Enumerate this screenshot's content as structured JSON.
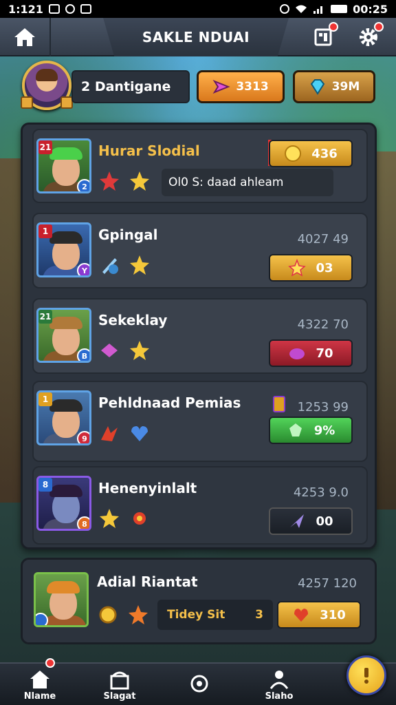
{
  "status_bar": {
    "time_left": "1:121",
    "time_right": "00:25"
  },
  "header": {
    "title": "SAKLE NDUAI"
  },
  "player": {
    "name": "2 Dantigane"
  },
  "currency": [
    {
      "value": "3313"
    },
    {
      "value": "39M"
    }
  ],
  "list": [
    {
      "level": "21",
      "class": "2",
      "name": "Hurar Slodial",
      "button": "436",
      "tag": "Ol0 S: daad ahleam",
      "icons": [
        "red-star-icon",
        "gold-star-icon"
      ]
    },
    {
      "level": "1",
      "class": "Y",
      "name": "Gpingal",
      "score": "4027 49",
      "button": "03",
      "icons": [
        "sword-shield-icon",
        "gold-star-icon"
      ]
    },
    {
      "level": "21",
      "class": "B",
      "name": "Sekeklay",
      "score": "4322 70",
      "button": "70",
      "icons": [
        "pink-gem-icon",
        "gold-star-icon"
      ]
    },
    {
      "level": "1",
      "class": "9",
      "name": "Pehldnaad Pemias",
      "score": "1253 99",
      "button": "9%",
      "icons": [
        "red-wing-icon",
        "blue-heart-icon"
      ]
    },
    {
      "level": "8",
      "class": "8",
      "name": "Henenyinlalt",
      "score": "4253 9.0",
      "button": "00",
      "icons": [
        "gold-star-icon",
        "red-flower-icon"
      ]
    }
  ],
  "card": {
    "name": "Adial Riantat",
    "score": "4257 120",
    "chip_label": "Tidey Sit",
    "chip_value": "3",
    "button": "310",
    "icons": [
      "gold-medal-icon",
      "fire-star-icon"
    ]
  },
  "bottom_nav": [
    {
      "label": "Nlame"
    },
    {
      "label": "Slagat"
    },
    {
      "label": ""
    },
    {
      "label": "Slaho"
    }
  ],
  "colors": {
    "accent_gold": "#f5c24a",
    "accent_red": "#cf3545",
    "accent_green": "#52d45a",
    "panel": "#2c333d"
  }
}
